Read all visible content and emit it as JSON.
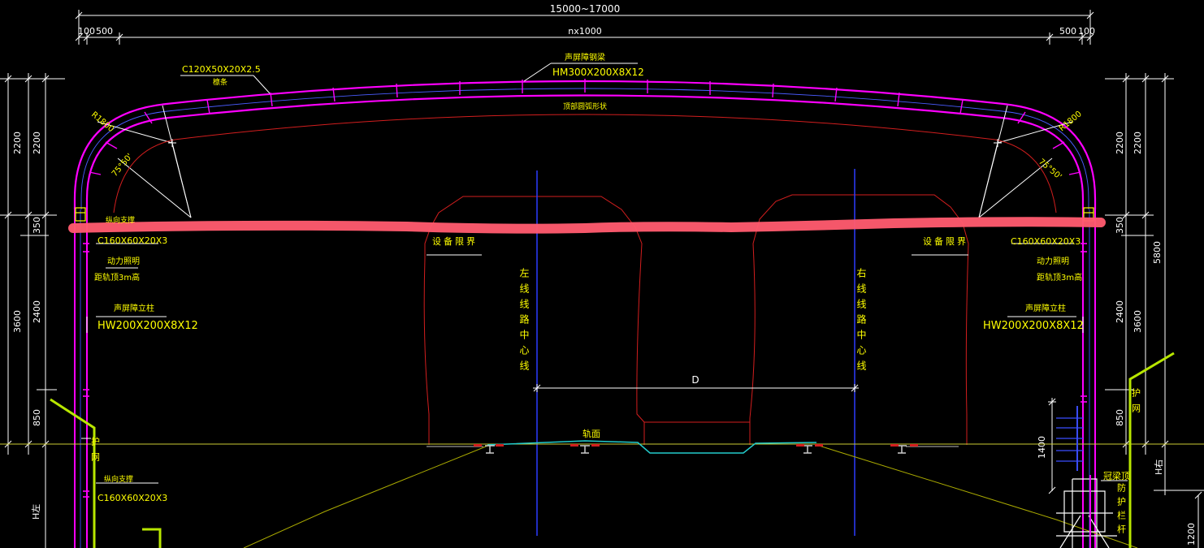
{
  "colors": {
    "background": "#000000",
    "dimension": "#ffffff",
    "steel": "#ff00ff",
    "label": "#ffff00",
    "outline": "#d21e1e",
    "center_line": "#2c3cff",
    "ground": "#aaaa00",
    "highlight": "#ff5b6e",
    "guard": "#b8e600",
    "track": "#22cccc"
  },
  "dimensions": {
    "top_total": "15000~17000",
    "spacing": "nx1000",
    "left_100": "100",
    "left_500": "500",
    "right_500": "500",
    "right_100": "100",
    "left_2200_a": "2200",
    "left_2200_b": "2200",
    "left_350": "350",
    "left_3600": "3600",
    "left_2400": "2400",
    "left_850": "850",
    "left_H": "H左",
    "right_2200_a": "2200",
    "right_2200_b": "2200",
    "right_350": "350",
    "right_5800": "5800",
    "right_2400": "2400",
    "right_3600": "3600",
    "right_850": "850",
    "right_1400": "1400",
    "right_H": "H右",
    "right_1200": "1200"
  },
  "labels": {
    "purlin_spec": "C120X50X20X2.5",
    "purlin_name": "檩条",
    "beam_name": "声屏障钢梁",
    "beam_spec": "HM300X200X8X12",
    "arc_surface": "顶部圆弧形状",
    "radius_left": "R1800",
    "radius_right": "R1800",
    "angle_left": "75°50'",
    "angle_right": "75°50'",
    "brace_left": "纵向支撑",
    "brace_left_spec": "C160X60X20X3",
    "brace_right_spec": "C160X60X20X3",
    "power_left": "动力照明",
    "power_right": "动力照明",
    "rail_height_left": "距轨顶3m高",
    "rail_height_right": "距轨顶3m高",
    "column_left": "声屏障立柱",
    "column_left_spec": "HW200X200X8X12",
    "column_right": "声屏障立柱",
    "column_right_spec": "HW200X200X8X12",
    "equip_left": "设备限界",
    "equip_right": "设备限界",
    "left_center": "左线线路中心线",
    "right_center": "右线线路中心线",
    "span_d": "D",
    "rail_top": "轨面",
    "guard_left": "护网",
    "guard_right": "护网",
    "lower_brace": "纵向支撑",
    "lower_brace_spec": "C160X60X20X3",
    "crown_beam": "冠梁顶",
    "parapet": "防护栏杆"
  }
}
